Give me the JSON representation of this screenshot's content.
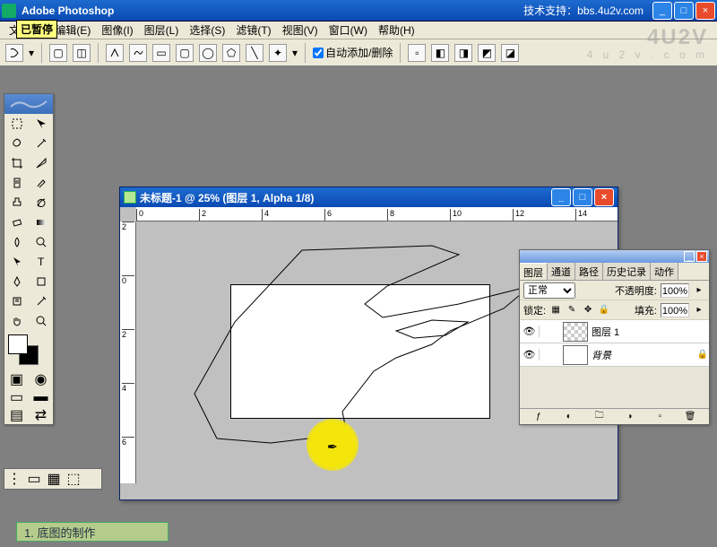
{
  "titlebar": {
    "appname": "Adobe Photoshop",
    "support": "技术支持：bbs.4u2v.com"
  },
  "pause_badge": "已暂停",
  "menu": {
    "file": "文件(F)",
    "edit": "编辑(E)",
    "image": "图像(I)",
    "layer": "图层(L)",
    "select": "选择(S)",
    "filter": "滤镜(T)",
    "view": "视图(V)",
    "window": "窗口(W)",
    "help": "帮助(H)"
  },
  "optionbar": {
    "auto_add_delete": "自动添加/删除"
  },
  "doc": {
    "title": "未标题-1 @ 25% (图层 1, Alpha 1/8)",
    "ruler_h": [
      "0",
      "2",
      "4",
      "6",
      "8",
      "10",
      "12",
      "14"
    ],
    "ruler_v": [
      "2",
      "0",
      "2",
      "4",
      "6"
    ]
  },
  "panels": {
    "tabs": {
      "layers": "图层",
      "channels": "通道",
      "paths": "路径",
      "history": "历史记录",
      "actions": "动作"
    },
    "blend_mode": "正常",
    "opacity_label": "不透明度:",
    "opacity": "100%",
    "lock_label": "锁定:",
    "fill_label": "填充:",
    "fill": "100%",
    "layer1": "图层 1",
    "bg": "背景"
  },
  "watermark": {
    "main": "4U2V",
    "sub": "4 u 2 v . c o m"
  },
  "caption": "1. 底图的制作"
}
